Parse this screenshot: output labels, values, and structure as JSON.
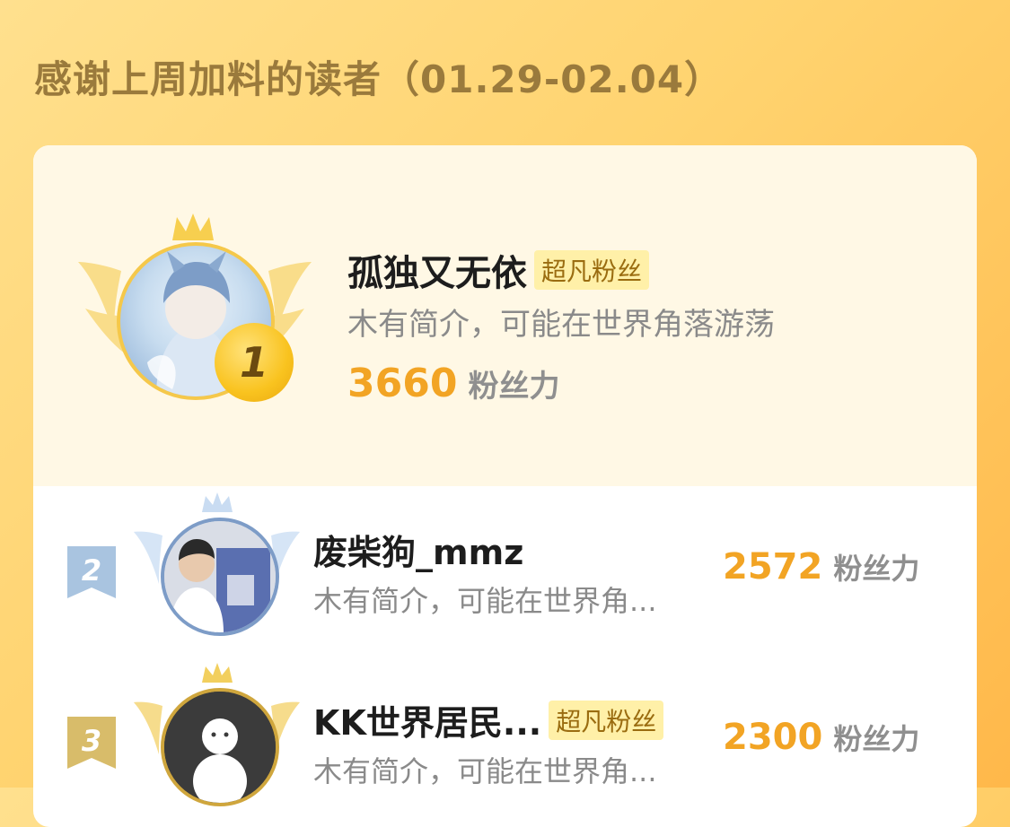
{
  "header": {
    "title": "感谢上周加料的读者（01.29-02.04）"
  },
  "first": {
    "rank": "1",
    "name": "孤独又无依",
    "tag": "超凡粉丝",
    "desc": "木有简介，可能在世界角落游荡",
    "score": "3660",
    "score_label": "粉丝力"
  },
  "rows": [
    {
      "rank": "2",
      "name": "废柴狗_mmz",
      "tag": "",
      "desc": "木有简介，可能在世界角...",
      "score": "2572",
      "score_label": "粉丝力",
      "flag_color": "#a9c4e0"
    },
    {
      "rank": "3",
      "name": "KK世界居民...",
      "tag": "超凡粉丝",
      "desc": "木有简介，可能在世界角...",
      "score": "2300",
      "score_label": "粉丝力",
      "flag_color": "#d8bc6a"
    }
  ],
  "colors": {
    "accent": "#f2a424",
    "tag_bg": "#fff0a8",
    "tag_text": "#9a6c10",
    "title": "#9a7a3c",
    "gold_wings": "#f7d77a",
    "silver_wings": "#c9dcf2"
  }
}
